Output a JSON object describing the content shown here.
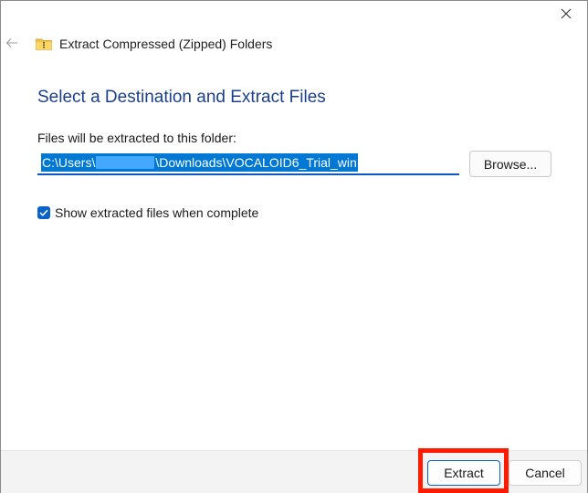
{
  "window": {
    "title": "Extract Compressed (Zipped) Folders",
    "icon": "zip-folder-icon"
  },
  "controls": {
    "close_icon": "close-icon",
    "back_icon": "back-arrow-icon"
  },
  "main": {
    "heading": "Select a Destination and Extract Files",
    "destination_label": "Files will be extracted to this folder:",
    "path_prefix": "C:\\Users\\",
    "path_suffix": "\\Downloads\\VOCALOID6_Trial_win",
    "browse_label": "Browse...",
    "show_files_label": "Show extracted files when complete",
    "show_files_checked": true
  },
  "footer": {
    "extract_label": "Extract",
    "cancel_label": "Cancel"
  },
  "colors": {
    "heading": "#1b3f8b",
    "selection": "#0078d4",
    "accent": "#0a62c9",
    "annotation": "#ff1a00",
    "footer_bg": "#f3f3f3"
  }
}
